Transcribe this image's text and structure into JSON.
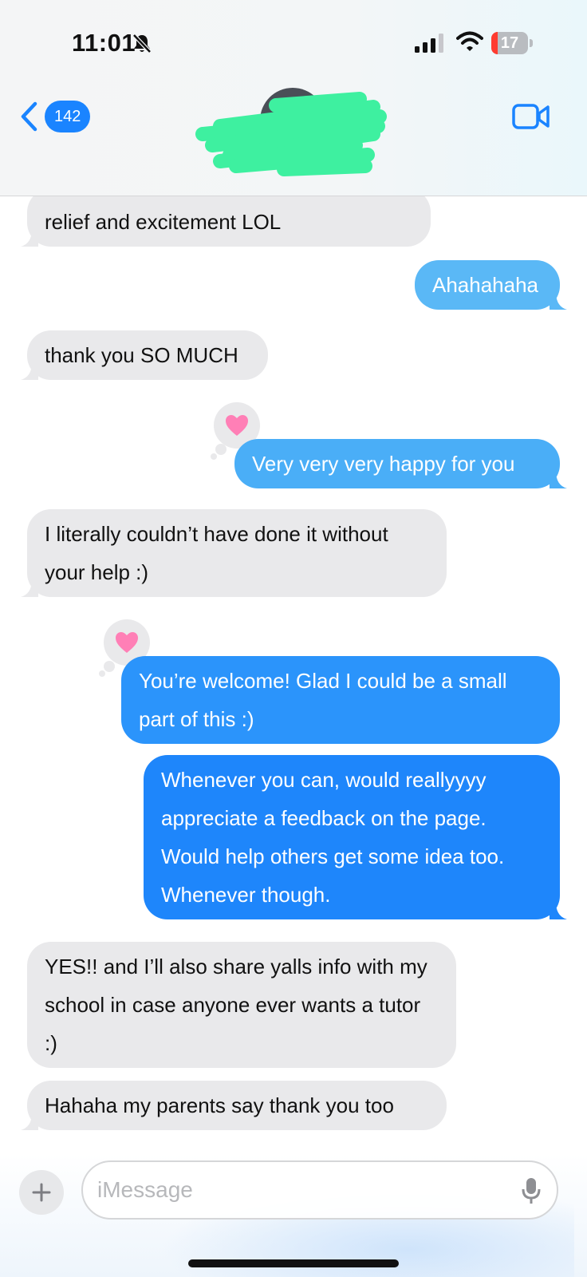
{
  "status_bar": {
    "time": "11:01",
    "battery_level": "17",
    "battery_fraction": 0.17
  },
  "header": {
    "back_count": "142",
    "contact_name_redacted": true
  },
  "messages": [
    {
      "direction": "received",
      "text": "relief and excitement LOL"
    },
    {
      "direction": "sent",
      "text": "Ahahahaha"
    },
    {
      "direction": "received",
      "text": "thank you SO MUCH"
    },
    {
      "direction": "sent",
      "text": "Very very very happy for you",
      "reaction": "pink-heart"
    },
    {
      "direction": "received",
      "text": "I literally couldn’t have done it without your help :)"
    },
    {
      "direction": "sent",
      "text": "You’re welcome! Glad I could be a small part of this :)",
      "reaction": "pink-heart"
    },
    {
      "direction": "sent",
      "text": "Whenever you can, would reallyyyy appreciate a feedback on the page. Would help others get some idea too. Whenever though."
    },
    {
      "direction": "received",
      "text": "YES!! and I’ll also share yalls info with my school in case anyone ever wants a tutor :)"
    },
    {
      "direction": "received",
      "text": "Hahaha my parents say thank you too"
    }
  ],
  "input": {
    "placeholder": "iMessage"
  },
  "colors": {
    "sent_top": "#5ab8f6",
    "sent_bottom": "#1a84ff",
    "received": "#e9e9eb",
    "accent": "#1a84ff",
    "redaction": "#3ef0a0"
  }
}
